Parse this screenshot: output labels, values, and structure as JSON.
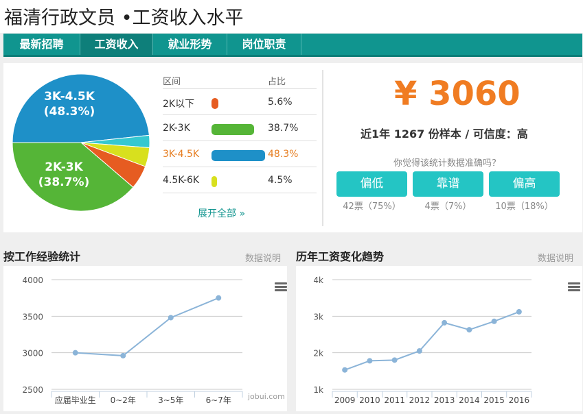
{
  "page": {
    "title": "福清行政文员 •工资收入水平"
  },
  "tabs": [
    {
      "label": "最新招聘",
      "active": false
    },
    {
      "label": "工资收入",
      "active": true
    },
    {
      "label": "就业形势",
      "active": false
    },
    {
      "label": "岗位职责",
      "active": false
    }
  ],
  "distribution": {
    "col_range": "区间",
    "col_pct": "占比",
    "rows": [
      {
        "range": "2K以下",
        "pct": "5.6%",
        "value": 5.6,
        "color": "#e65c21"
      },
      {
        "range": "2K-3K",
        "pct": "38.7%",
        "value": 38.7,
        "color": "#55b537"
      },
      {
        "range": "3K-4.5K",
        "pct": "48.3%",
        "value": 48.3,
        "color": "#1e90c8",
        "highlight": true
      },
      {
        "range": "4.5K-6K",
        "pct": "4.5%",
        "value": 4.5,
        "color": "#d8e01e"
      }
    ],
    "expand_label": "展开全部 »",
    "pie_labels": [
      {
        "range": "3K-4.5K",
        "pct": "(48.3%)"
      },
      {
        "range": "2K-3K",
        "pct": "(38.7%)"
      }
    ]
  },
  "summary": {
    "salary": "¥ 3060",
    "sample_text": "近1年 1267 份样本 / 可信度：高",
    "question": "你觉得该统计数据准确吗？",
    "votes": [
      {
        "label": "偏低",
        "count": "42票（75%）"
      },
      {
        "label": "靠谱",
        "count": "4票（7%）"
      },
      {
        "label": "偏高",
        "count": "10票（18%）"
      }
    ]
  },
  "experience_section": {
    "title": "按工作经验统计",
    "note": "数据说明"
  },
  "trend_section": {
    "title": "历年工资变化趋势",
    "note": "数据说明"
  },
  "watermark": "jobui.com",
  "chart_data": [
    {
      "type": "line",
      "categories": [
        "应届毕业生",
        "0~2年",
        "3~5年",
        "6~7年"
      ],
      "values": [
        3000,
        2960,
        3480,
        3750
      ],
      "ylim": [
        2500,
        4000
      ],
      "yticks": [
        "2500",
        "3000",
        "3500",
        "4000"
      ],
      "grid": true,
      "color": "#8bb4d8"
    },
    {
      "type": "line",
      "categories": [
        "2009",
        "2010",
        "2011",
        "2012",
        "2013",
        "2014",
        "2015",
        "2016"
      ],
      "values": [
        1530,
        1780,
        1800,
        2050,
        2820,
        2630,
        2860,
        3120
      ],
      "ylim": [
        1000,
        4000
      ],
      "yticks": [
        "1k",
        "2k",
        "3k",
        "4k"
      ],
      "grid": true,
      "color": "#8bb4d8"
    }
  ]
}
